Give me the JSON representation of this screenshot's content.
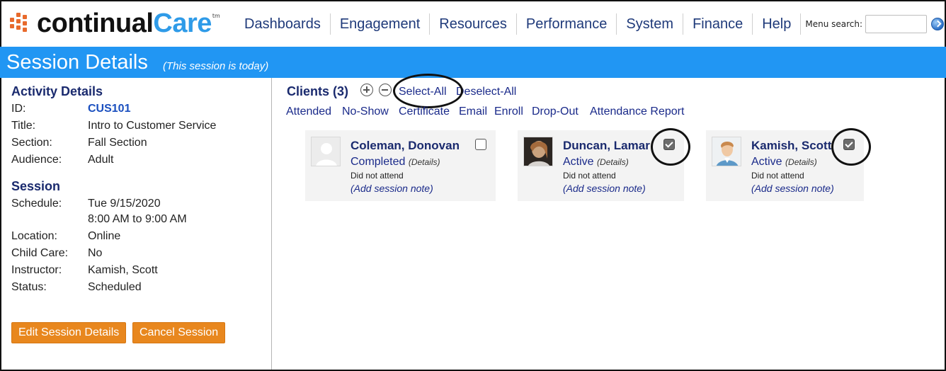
{
  "logo": {
    "word1": "continual",
    "word2": "Care",
    "tm": "tm"
  },
  "nav": [
    {
      "label": "Dashboards"
    },
    {
      "label": "Engagement"
    },
    {
      "label": "Resources"
    },
    {
      "label": "Performance"
    },
    {
      "label": "System"
    },
    {
      "label": "Finance"
    },
    {
      "label": "Help"
    }
  ],
  "menu_search": {
    "label": "Menu search:",
    "value": "",
    "placeholder": ""
  },
  "page": {
    "title": "Session Details",
    "note": "(This session is today)"
  },
  "activity": {
    "heading": "Activity Details",
    "fields": [
      {
        "label": "ID:",
        "value": "CUS101"
      },
      {
        "label": "Title:",
        "value": "Intro to Customer Service"
      },
      {
        "label": "Section:",
        "value": "Fall Section"
      },
      {
        "label": "Audience:",
        "value": "Adult"
      }
    ]
  },
  "session": {
    "heading": "Session",
    "schedule_label": "Schedule:",
    "schedule_date": "Tue 9/15/2020",
    "schedule_time": "8:00 AM to 9:00 AM",
    "fields": [
      {
        "label": "Location:",
        "value": "Online"
      },
      {
        "label": "Child Care:",
        "value": "No"
      },
      {
        "label": "Instructor:",
        "value": "Kamish, Scott"
      },
      {
        "label": "Status:",
        "value": "Scheduled"
      }
    ]
  },
  "buttons": {
    "edit": "Edit Session Details",
    "cancel": "Cancel Session"
  },
  "clients": {
    "heading": "Clients (3)",
    "select_all": "Select-All",
    "deselect_all": "Deselect-All",
    "actions": [
      "Attended",
      "No-Show",
      "Certificate",
      "Email",
      "Enroll",
      "Drop-Out",
      "Attendance Report"
    ],
    "cards": [
      {
        "name": "Coleman, Donovan",
        "status": "Completed",
        "details": "(Details)",
        "attendance": "Did not attend",
        "note": "(Add session note)",
        "checked": false
      },
      {
        "name": "Duncan, Lamar",
        "status": "Active",
        "details": "(Details)",
        "attendance": "Did not attend",
        "note": "(Add session note)",
        "checked": true
      },
      {
        "name": "Kamish, Scott",
        "status": "Active",
        "details": "(Details)",
        "attendance": "Did not attend",
        "note": "(Add session note)",
        "checked": true
      }
    ]
  },
  "colors": {
    "band": "#2196f3",
    "accent_orange": "#e8871e",
    "heading_navy": "#1a2a6e",
    "brand_blue": "#2f9be8"
  },
  "icons": {
    "search_go": "go-arrow-icon",
    "expand": "plus-circle-icon",
    "collapse": "minus-circle-icon"
  }
}
